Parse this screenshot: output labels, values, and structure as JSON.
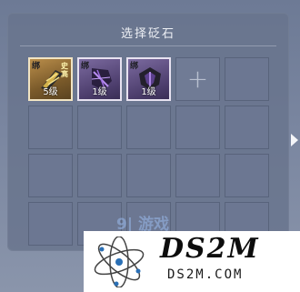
{
  "dialog": {
    "title": "选择砭石",
    "grid": {
      "rows": 4,
      "cols": 5,
      "items": [
        {
          "bind_label": "绑",
          "tag": "史高",
          "level": "5级",
          "rarity_color": "#b98d4a"
        },
        {
          "bind_label": "绑",
          "tag": "",
          "level": "1级",
          "rarity_color": "#7b6a9f"
        },
        {
          "bind_label": "绑",
          "tag": "",
          "level": "1级",
          "rarity_color": "#7b6a9f"
        }
      ],
      "add_icon": "plus-icon"
    },
    "side_arrow_icon": "chevron-right-icon"
  },
  "watermark": {
    "game_logo_text": "9| 游戏",
    "site_big": "DS2M",
    "site_small": "DS2M.COM"
  }
}
